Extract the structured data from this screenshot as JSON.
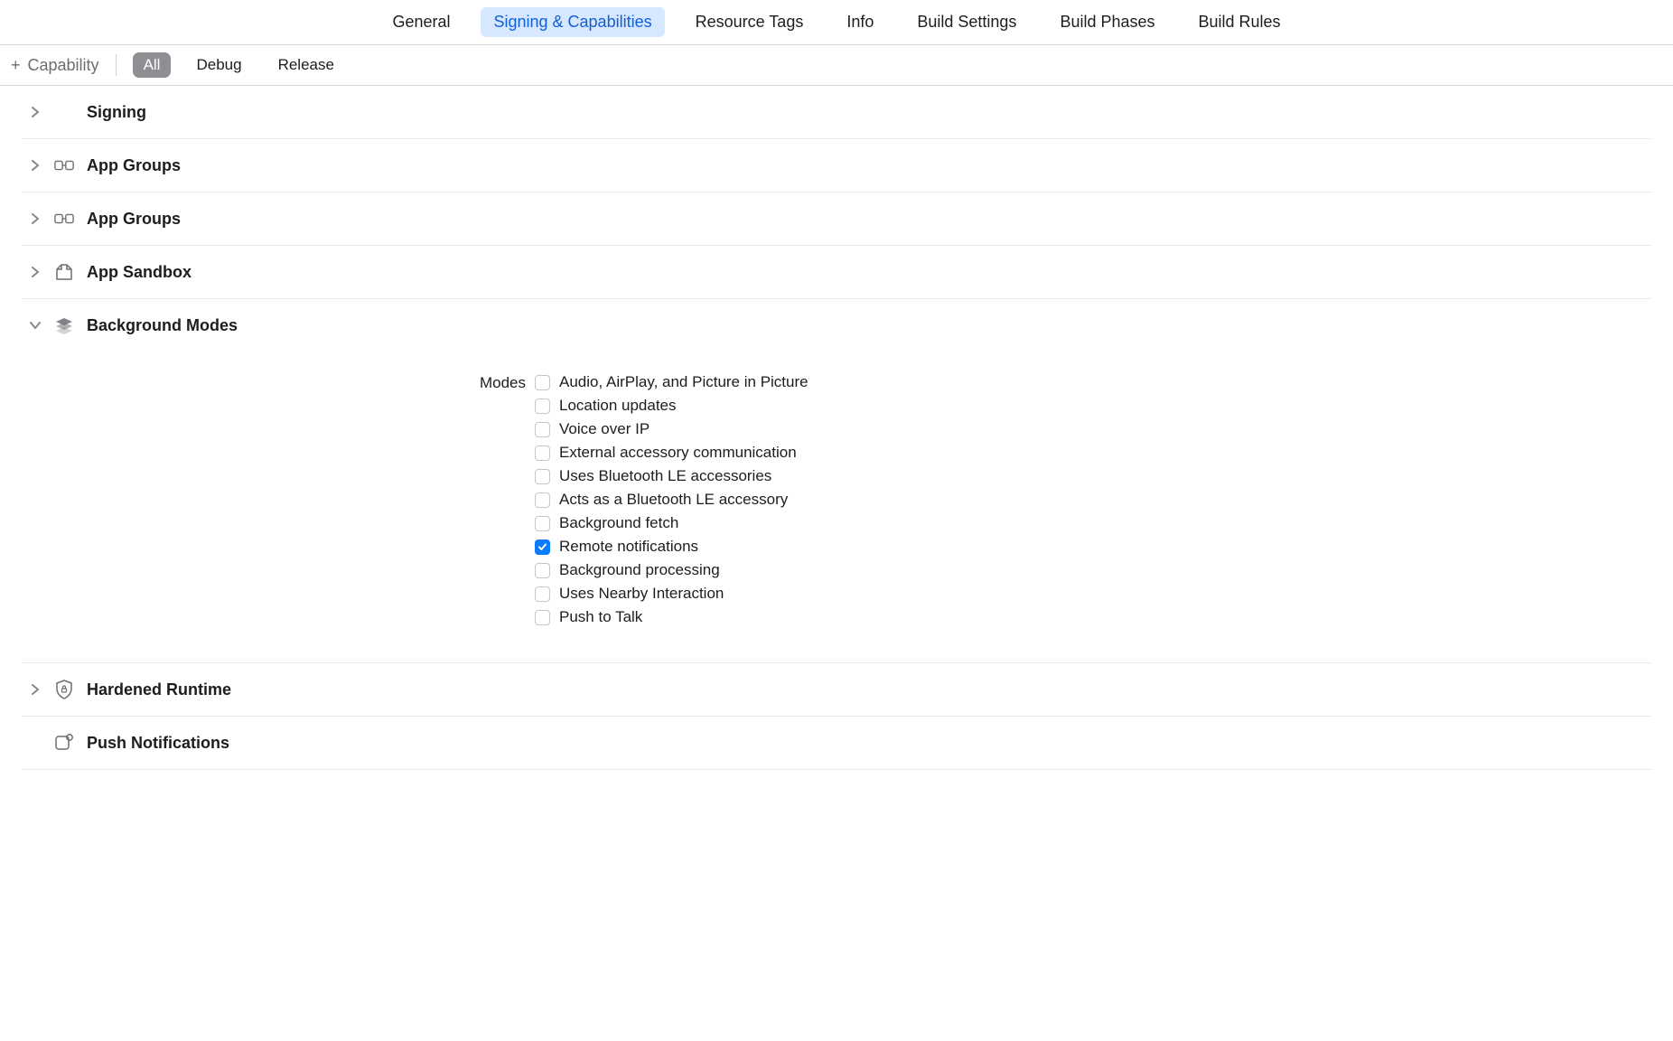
{
  "topTabs": {
    "general": "General",
    "signing": "Signing & Capabilities",
    "resourceTags": "Resource Tags",
    "info": "Info",
    "buildSettings": "Build Settings",
    "buildPhases": "Build Phases",
    "buildRules": "Build Rules",
    "active": "signing"
  },
  "subBar": {
    "addCapability": "Capability",
    "configs": {
      "all": "All",
      "debug": "Debug",
      "release": "Release"
    },
    "activeConfig": "all"
  },
  "sections": {
    "signing": {
      "title": "Signing"
    },
    "appGroups1": {
      "title": "App Groups"
    },
    "appGroups2": {
      "title": "App Groups"
    },
    "appSandbox": {
      "title": "App Sandbox"
    },
    "backgroundModes": {
      "title": "Background Modes",
      "modesLabel": "Modes",
      "modes": [
        {
          "label": "Audio, AirPlay, and Picture in Picture",
          "checked": false
        },
        {
          "label": "Location updates",
          "checked": false
        },
        {
          "label": "Voice over IP",
          "checked": false
        },
        {
          "label": "External accessory communication",
          "checked": false
        },
        {
          "label": "Uses Bluetooth LE accessories",
          "checked": false
        },
        {
          "label": "Acts as a Bluetooth LE accessory",
          "checked": false
        },
        {
          "label": "Background fetch",
          "checked": false
        },
        {
          "label": "Remote notifications",
          "checked": true
        },
        {
          "label": "Background processing",
          "checked": false
        },
        {
          "label": "Uses Nearby Interaction",
          "checked": false
        },
        {
          "label": "Push to Talk",
          "checked": false
        }
      ]
    },
    "hardenedRuntime": {
      "title": "Hardened Runtime"
    },
    "pushNotifications": {
      "title": "Push Notifications"
    }
  }
}
